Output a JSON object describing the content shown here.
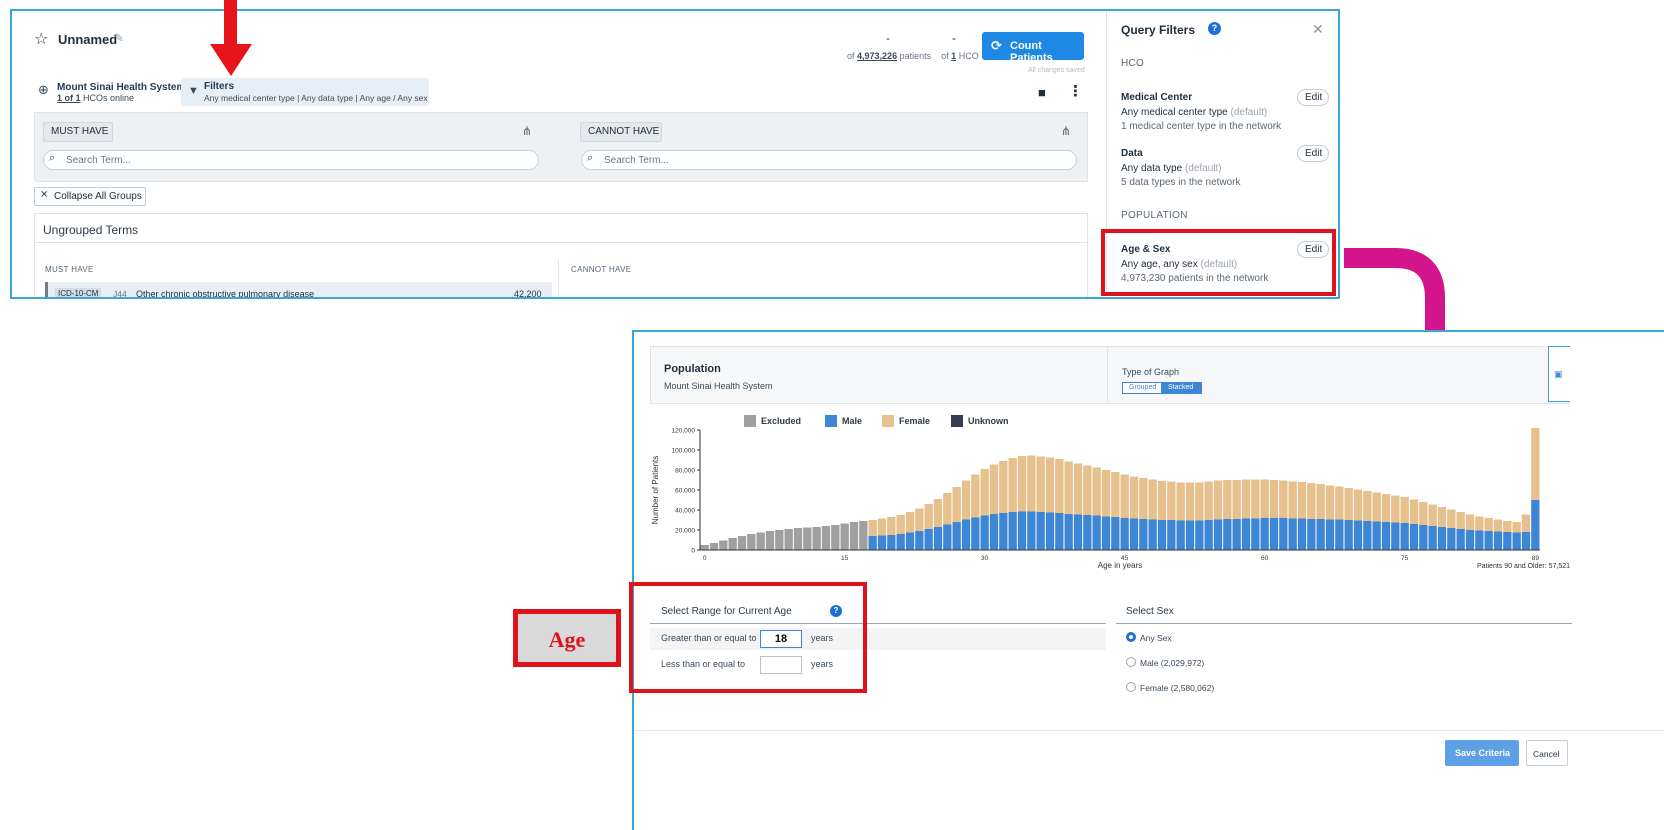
{
  "header": {
    "title": "Unnamed",
    "patients_dash": "-",
    "hco_dash": "-",
    "of_patients_prefix": "of",
    "patients_count": "4,973,226",
    "patients_suffix": "patients",
    "of_hco_prefix": "of",
    "hco_count": "1",
    "hco_suffix": "HCO",
    "count_button": "Count Patients",
    "saved_status": "All changes saved"
  },
  "network": {
    "name": "Mount Sinai Health System",
    "hcos_link": "1 of 1",
    "hcos_suffix": "HCOs online"
  },
  "filters": {
    "label": "Filters",
    "summary": "Any medical center type | Any data type | Any age / Any sex"
  },
  "criteria": {
    "must_have": "MUST HAVE",
    "cannot_have": "CANNOT HAVE",
    "search_placeholder": "Search Term...",
    "collapse_all": "Collapse All Groups",
    "ungrouped_title": "Ungrouped Terms",
    "col_must": "MUST HAVE",
    "col_cannot": "CANNOT HAVE",
    "term": {
      "code_system": "ICD-10-CM",
      "code": "J44",
      "name": "Other chronic obstructive pulmonary disease",
      "count": "42,200"
    }
  },
  "query_filters": {
    "title": "Query Filters",
    "hco_section": "HCO",
    "population_section": "POPULATION",
    "edit_label": "Edit",
    "medical_center": {
      "title": "Medical Center",
      "value": "Any medical center type",
      "default": "(default)",
      "detail": "1 medical center type in the network"
    },
    "data": {
      "title": "Data",
      "value": "Any data type",
      "default": "(default)",
      "detail": "5 data types in the network"
    },
    "age_sex": {
      "title": "Age & Sex",
      "value": "Any age, any sex",
      "default": "(default)",
      "detail": "4,973,230 patients in the network"
    }
  },
  "population": {
    "title": "Population",
    "subtitle": "Mount Sinai Health System",
    "graph_type_label": "Type of Graph",
    "graph_types": [
      "Grouped",
      "Stacked"
    ],
    "graph_type_selected": "Stacked"
  },
  "age_range": {
    "title": "Select Range for Current Age",
    "gte_label": "Greater than or equal to",
    "gte_value": "18",
    "lte_label": "Less than or equal to",
    "lte_value": "",
    "unit": "years"
  },
  "sex": {
    "title": "Select Sex",
    "options": [
      "Any Sex",
      "Male (2,029,972)",
      "Female (2,580,062)"
    ],
    "selected": "Any Sex"
  },
  "actions": {
    "save": "Save Criteria",
    "cancel": "Cancel"
  },
  "callout": {
    "label": "Age"
  },
  "colors": {
    "excluded": "#a0a0a0",
    "male": "#3d86d6",
    "female": "#e6c08d",
    "unknown": "#344050",
    "accent": "#1e88e5",
    "highlight": "#e0121b",
    "arrow": "#d4148c"
  },
  "chart_data": {
    "type": "bar",
    "stacked": true,
    "xlabel": "Age in years",
    "ylabel": "Number of Patients",
    "ylim": [
      0,
      120000
    ],
    "yticks": [
      "0",
      "20,000",
      "40,000",
      "60,000",
      "80,000",
      "100,000",
      "120,000"
    ],
    "xticks": [
      "0",
      "15",
      "30",
      "45",
      "60",
      "75",
      "89"
    ],
    "legend": [
      "Excluded",
      "Male",
      "Female",
      "Unknown"
    ],
    "footnote": "Patients 90 and Older: 57,521",
    "x": [
      0,
      1,
      2,
      3,
      4,
      5,
      6,
      7,
      8,
      9,
      10,
      11,
      12,
      13,
      14,
      15,
      16,
      17,
      18,
      19,
      20,
      21,
      22,
      23,
      24,
      25,
      26,
      27,
      28,
      29,
      30,
      31,
      32,
      33,
      34,
      35,
      36,
      37,
      38,
      39,
      40,
      41,
      42,
      43,
      44,
      45,
      46,
      47,
      48,
      49,
      50,
      51,
      52,
      53,
      54,
      55,
      56,
      57,
      58,
      59,
      60,
      61,
      62,
      63,
      64,
      65,
      66,
      67,
      68,
      69,
      70,
      71,
      72,
      73,
      74,
      75,
      76,
      77,
      78,
      79,
      80,
      81,
      82,
      83,
      84,
      85,
      86,
      87,
      88,
      89
    ],
    "series": [
      {
        "name": "Excluded",
        "values": [
          5000,
          7000,
          9500,
          12000,
          14000,
          16000,
          17500,
          19000,
          20000,
          21000,
          22000,
          22500,
          23000,
          24000,
          25000,
          26500,
          28000,
          29000,
          0,
          0,
          0,
          0,
          0,
          0,
          0,
          0,
          0,
          0,
          0,
          0,
          0,
          0,
          0,
          0,
          0,
          0,
          0,
          0,
          0,
          0,
          0,
          0,
          0,
          0,
          0,
          0,
          0,
          0,
          0,
          0,
          0,
          0,
          0,
          0,
          0,
          0,
          0,
          0,
          0,
          0,
          0,
          0,
          0,
          0,
          0,
          0,
          0,
          0,
          0,
          0,
          0,
          0,
          0,
          0,
          0,
          0,
          0,
          0,
          0,
          0,
          0,
          0,
          0,
          0,
          0,
          0,
          0,
          0,
          0,
          0
        ]
      },
      {
        "name": "Male",
        "values": [
          0,
          0,
          0,
          0,
          0,
          0,
          0,
          0,
          0,
          0,
          0,
          0,
          0,
          0,
          0,
          0,
          0,
          0,
          14000,
          14500,
          15000,
          16000,
          17500,
          19000,
          21000,
          23000,
          25500,
          28000,
          30500,
          32500,
          34500,
          36000,
          37000,
          38000,
          38500,
          38500,
          38000,
          37500,
          37000,
          36000,
          35500,
          35000,
          34500,
          33500,
          33000,
          32000,
          31500,
          31000,
          30500,
          30000,
          30000,
          29500,
          29500,
          29500,
          30000,
          30500,
          31000,
          31000,
          31500,
          31500,
          32000,
          32000,
          32000,
          31500,
          31500,
          31000,
          31000,
          30500,
          30500,
          30000,
          29500,
          29000,
          28500,
          28000,
          27500,
          27000,
          26000,
          25000,
          24000,
          23000,
          22000,
          21000,
          20000,
          19500,
          19000,
          18500,
          18000,
          17500,
          18000,
          50000
        ]
      },
      {
        "name": "Female",
        "values": [
          0,
          0,
          0,
          0,
          0,
          0,
          0,
          0,
          0,
          0,
          0,
          0,
          0,
          0,
          0,
          0,
          0,
          0,
          16000,
          17000,
          18000,
          19000,
          20500,
          22500,
          25000,
          28000,
          31500,
          35000,
          39000,
          43000,
          46500,
          49500,
          52000,
          54000,
          55500,
          56000,
          55500,
          55000,
          54000,
          52500,
          51000,
          49500,
          48000,
          46500,
          45000,
          43500,
          42000,
          41000,
          40000,
          39000,
          38500,
          38000,
          38000,
          38000,
          38500,
          39000,
          39000,
          39000,
          39000,
          39000,
          38500,
          38000,
          37500,
          37000,
          36500,
          36000,
          35000,
          34000,
          33000,
          32000,
          31000,
          30000,
          29000,
          28000,
          27000,
          26000,
          24500,
          23000,
          21500,
          20000,
          18500,
          17000,
          15500,
          14000,
          13000,
          12000,
          11000,
          10500,
          17500,
          72000
        ]
      },
      {
        "name": "Unknown",
        "values": [
          0,
          0,
          0,
          0,
          0,
          0,
          0,
          0,
          0,
          0,
          0,
          0,
          0,
          0,
          0,
          0,
          0,
          0,
          0,
          0,
          0,
          0,
          0,
          0,
          0,
          0,
          0,
          0,
          0,
          0,
          0,
          0,
          0,
          0,
          0,
          0,
          0,
          0,
          0,
          0,
          0,
          0,
          0,
          0,
          0,
          0,
          0,
          0,
          0,
          0,
          0,
          0,
          0,
          0,
          0,
          0,
          0,
          0,
          0,
          0,
          0,
          0,
          0,
          0,
          0,
          0,
          0,
          0,
          0,
          0,
          0,
          0,
          0,
          0,
          0,
          0,
          0,
          0,
          0,
          0,
          0,
          0,
          0,
          0,
          0,
          0,
          0,
          0,
          0,
          0
        ]
      }
    ]
  }
}
